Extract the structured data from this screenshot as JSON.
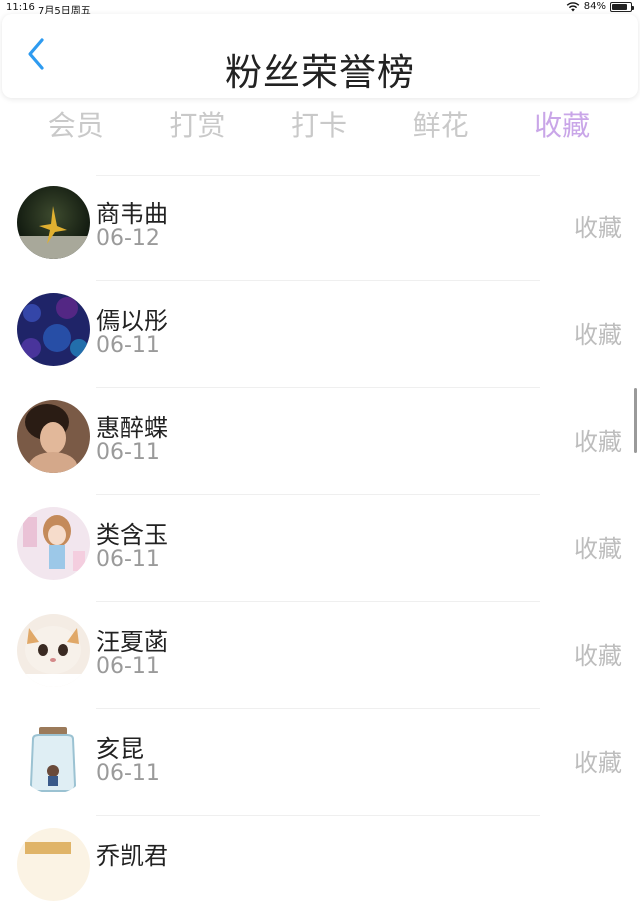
{
  "status": {
    "time": "11:16",
    "date": "7月5日周五",
    "battery": "84%",
    "battery_level": 0.84
  },
  "nav": {
    "title": "粉丝荣誉榜"
  },
  "tabs": [
    {
      "label": "会员"
    },
    {
      "label": "打赏"
    },
    {
      "label": "打卡"
    },
    {
      "label": "鲜花"
    },
    {
      "label": "收藏",
      "active": true
    }
  ],
  "list": [
    {
      "name": "商韦曲",
      "date": "06-12",
      "action": "收藏",
      "avatar": "avatar-paper-crane"
    },
    {
      "name": "傿以彤",
      "date": "06-11",
      "action": "收藏",
      "avatar": "avatar-blue-texture"
    },
    {
      "name": "惠醉蝶",
      "date": "06-11",
      "action": "收藏",
      "avatar": "avatar-woman-photo"
    },
    {
      "name": "类含玉",
      "date": "06-11",
      "action": "收藏",
      "avatar": "avatar-anime-girl"
    },
    {
      "name": "汪夏菡",
      "date": "06-11",
      "action": "收藏",
      "avatar": "avatar-cat"
    },
    {
      "name": "亥昆",
      "date": "06-11",
      "action": "收藏",
      "avatar": "avatar-jar"
    },
    {
      "name": "乔凯君",
      "date": "",
      "action": "",
      "avatar": "avatar-partial"
    }
  ],
  "colors": {
    "accent": "#2e9bf0",
    "active_tab": "#c9a6e8",
    "inactive_tab": "#c9c9c9"
  }
}
